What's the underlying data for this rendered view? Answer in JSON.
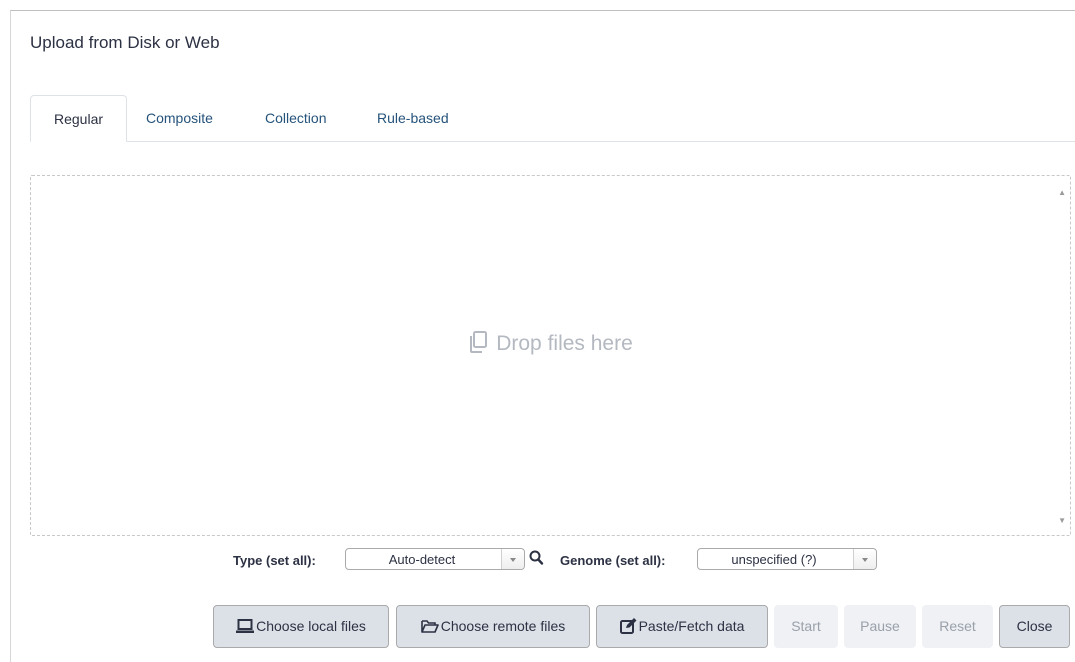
{
  "dialog": {
    "title": "Upload from Disk or Web"
  },
  "tabs": [
    {
      "label": "Regular",
      "active": true
    },
    {
      "label": "Composite",
      "active": false
    },
    {
      "label": "Collection",
      "active": false
    },
    {
      "label": "Rule-based",
      "active": false
    }
  ],
  "dropzone": {
    "icon": "copy-icon",
    "message": "Drop files here"
  },
  "settings": {
    "type_label": "Type (set all):",
    "type_value": "Auto-detect",
    "genome_label": "Genome (set all):",
    "genome_value": "unspecified (?)"
  },
  "buttons": {
    "choose_local": "Choose local files",
    "choose_remote": "Choose remote files",
    "paste_fetch": "Paste/Fetch data",
    "start": "Start",
    "pause": "Pause",
    "reset": "Reset",
    "close": "Close"
  },
  "colors": {
    "tab_link": "#25537b",
    "button_bg": "#dce1e8",
    "button_disabled_bg": "#eff1f5"
  }
}
